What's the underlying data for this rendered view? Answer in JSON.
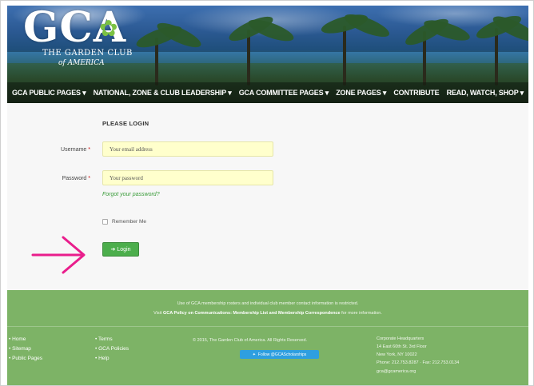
{
  "header": {
    "logo_text": "GCA",
    "logo_line1": "THE GARDEN CLUB",
    "logo_line2": "of AMERICA"
  },
  "nav": {
    "items": [
      {
        "label": "GCA PUBLIC PAGES ▾"
      },
      {
        "label": "NATIONAL, ZONE & CLUB LEADERSHIP ▾"
      },
      {
        "label": "GCA COMMITTEE PAGES ▾"
      },
      {
        "label": "ZONE PAGES ▾"
      },
      {
        "label": "CONTRIBUTE"
      },
      {
        "label": "READ, WATCH, SHOP ▾"
      }
    ]
  },
  "login": {
    "title": "PLEASE LOGIN",
    "username_label": "Username",
    "username_placeholder": "Your email address",
    "password_label": "Password",
    "password_placeholder": "Your password",
    "required_mark": "*",
    "forgot_link": "Forgot your password?",
    "remember_label": "Remember Me",
    "login_button": "Login",
    "login_icon": "sign-in-icon"
  },
  "annotation": {
    "arrow_color": "#e91e8c"
  },
  "footer": {
    "notice_line1": "Use of GCA membership rosters and individual club member contact information is restricted.",
    "notice_line2_pre": "Visit",
    "notice_line2_link": "GCA Policy on Communications: Membership List and Membership Correspondence",
    "notice_line2_post": "for more information.",
    "col1": [
      "• Home",
      "• Sitemap",
      "• Public Pages"
    ],
    "col2": [
      "• Terms",
      "• GCA Policies",
      "• Help"
    ],
    "copyright": "© 2015, The Garden Club of America. All Rights Reserved.",
    "follow_button": "Follow @GCAScholarships",
    "address": [
      "Corporate Headquarters",
      "14 East 60th St. 3rd Floor",
      "New York, NY 10022",
      "Phone: 212.753.8287 · Fax: 212.753.0134",
      "gca@gcamerica.org"
    ]
  },
  "colors": {
    "footer_green": "#7db366",
    "login_green": "#4cae4c",
    "input_yellow": "#ffffcc"
  }
}
